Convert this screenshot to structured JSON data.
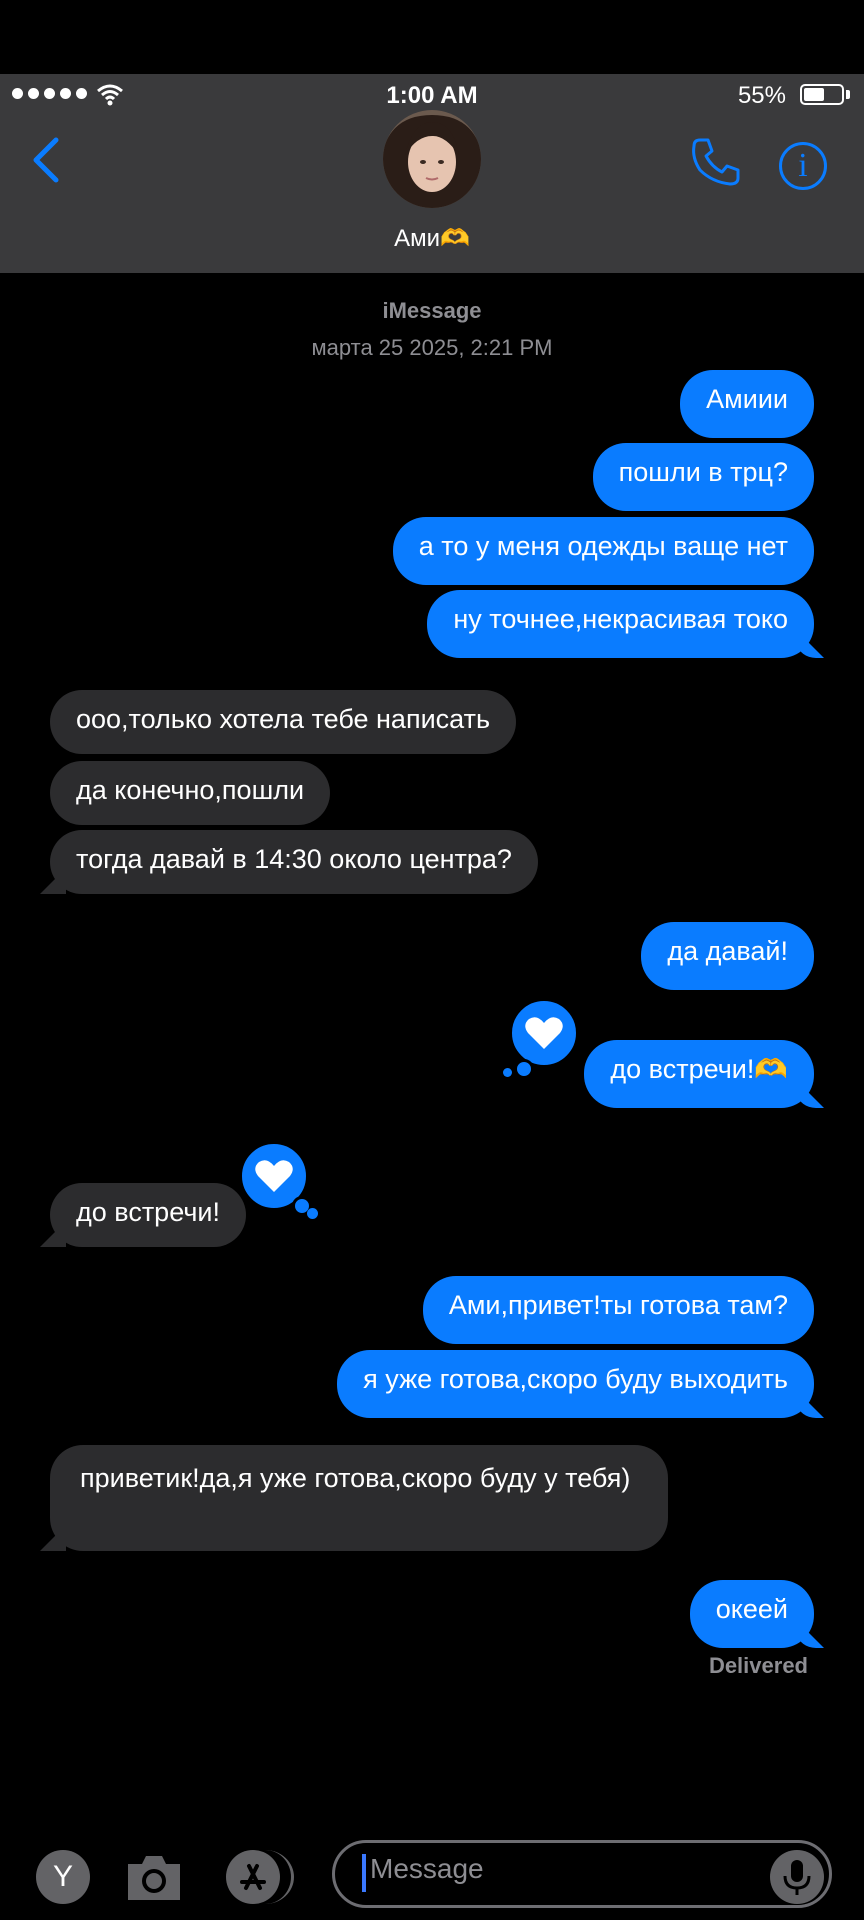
{
  "status": {
    "time": "1:00 AM",
    "battery": "55%",
    "battery_level": 0.55
  },
  "contact": {
    "name": "Ами🫶"
  },
  "meta": {
    "service": "iMessage",
    "timestamp": "марта 25 2025, 2:21 PM"
  },
  "messages": [
    {
      "from": "me",
      "text": "Амиии"
    },
    {
      "from": "me",
      "text": "пошли в трц?"
    },
    {
      "from": "me",
      "text": "а то у меня одежды ваще нет"
    },
    {
      "from": "me",
      "text": "ну точнее,некрасивая токо"
    },
    {
      "from": "them",
      "text": "ооо,только хотела тебе написать"
    },
    {
      "from": "them",
      "text": "да конечно,пошли"
    },
    {
      "from": "them",
      "text": "тогда давай в 14:30 около центра?"
    },
    {
      "from": "me",
      "text": "да давай!"
    },
    {
      "from": "me",
      "text": "до встречи!🫶",
      "tapback": "heart"
    },
    {
      "from": "them",
      "text": "до встречи!",
      "tapback": "heart"
    },
    {
      "from": "me",
      "text": "Ами,привет!ты готова там?"
    },
    {
      "from": "me",
      "text": "я уже готова,скоро буду выходить"
    },
    {
      "from": "them",
      "text": "приветик!да,я уже готова,скоро буду у тебя)"
    },
    {
      "from": "me",
      "text": "океей"
    }
  ],
  "delivered_label": "Delivered",
  "composer": {
    "placeholder": "Message",
    "apps_letter": "Y"
  },
  "colors": {
    "accent": "#0a7cff",
    "incoming": "#2c2c2e",
    "header": "#3a3a3c"
  },
  "icons": [
    "signal-icon",
    "wifi-icon",
    "battery-icon",
    "back-chevron-icon",
    "phone-icon",
    "info-icon",
    "heart-icon",
    "camera-icon",
    "app-store-icon",
    "microphone-icon"
  ]
}
